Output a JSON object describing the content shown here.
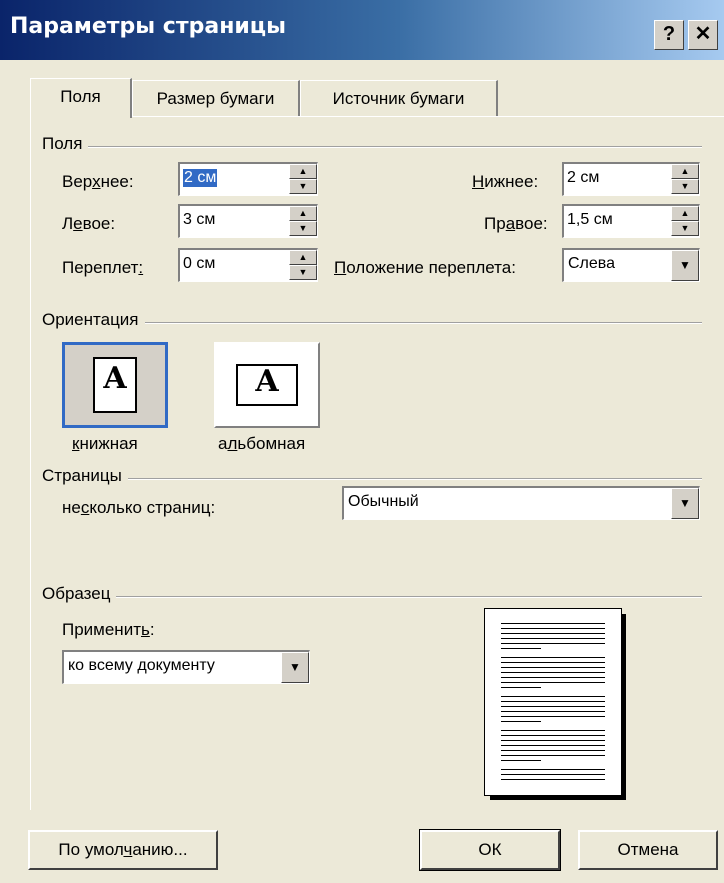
{
  "window": {
    "title": "Параметры страницы",
    "help_label": "?",
    "close_label": "✕"
  },
  "tabs": [
    {
      "label": "Поля",
      "active": true
    },
    {
      "label": "Размер бумаги",
      "active": false
    },
    {
      "label": "Источник бумаги",
      "active": false
    }
  ],
  "margins": {
    "group_label": "Поля",
    "top": {
      "label_a": "Вер",
      "label_u": "х",
      "label_b": "нее:",
      "value": "2 см"
    },
    "bottom": {
      "label_a": "",
      "label_u": "Н",
      "label_b": "ижнее:",
      "value": "2 см"
    },
    "left": {
      "label_a": "Л",
      "label_u": "е",
      "label_b": "вое:",
      "value": "3 см"
    },
    "right": {
      "label_a": "Пр",
      "label_u": "а",
      "label_b": "вое:",
      "value": "1,5 см"
    },
    "gutter": {
      "label_a": "Переплет",
      "label_u": ":",
      "label_b": "",
      "value": "0 см"
    },
    "gutter_pos": {
      "label_a": "",
      "label_u": "П",
      "label_b": "оложение переплета:",
      "value": "Слева"
    }
  },
  "orientation": {
    "group_label": "Ориентация",
    "portrait": {
      "label_a": "",
      "label_u": "к",
      "label_b": "нижная",
      "icon_letter": "A",
      "selected": true
    },
    "landscape": {
      "label_a": "а",
      "label_u": "л",
      "label_b": "ьбомная",
      "icon_letter": "A",
      "selected": false
    }
  },
  "pages": {
    "group_label": "Страницы",
    "multiple_label_a": "не",
    "multiple_label_u": "с",
    "multiple_label_b": "колько страниц:",
    "multiple_value": "Обычный"
  },
  "sample": {
    "group_label": "Образец",
    "apply_label_a": "Применит",
    "apply_label_u": "ь",
    "apply_label_b": ":",
    "apply_value": "ко всему документу"
  },
  "buttons": {
    "default_a": "По умол",
    "default_u": "ч",
    "default_b": "анию...",
    "ok": "ОК",
    "cancel": "Отмена"
  }
}
